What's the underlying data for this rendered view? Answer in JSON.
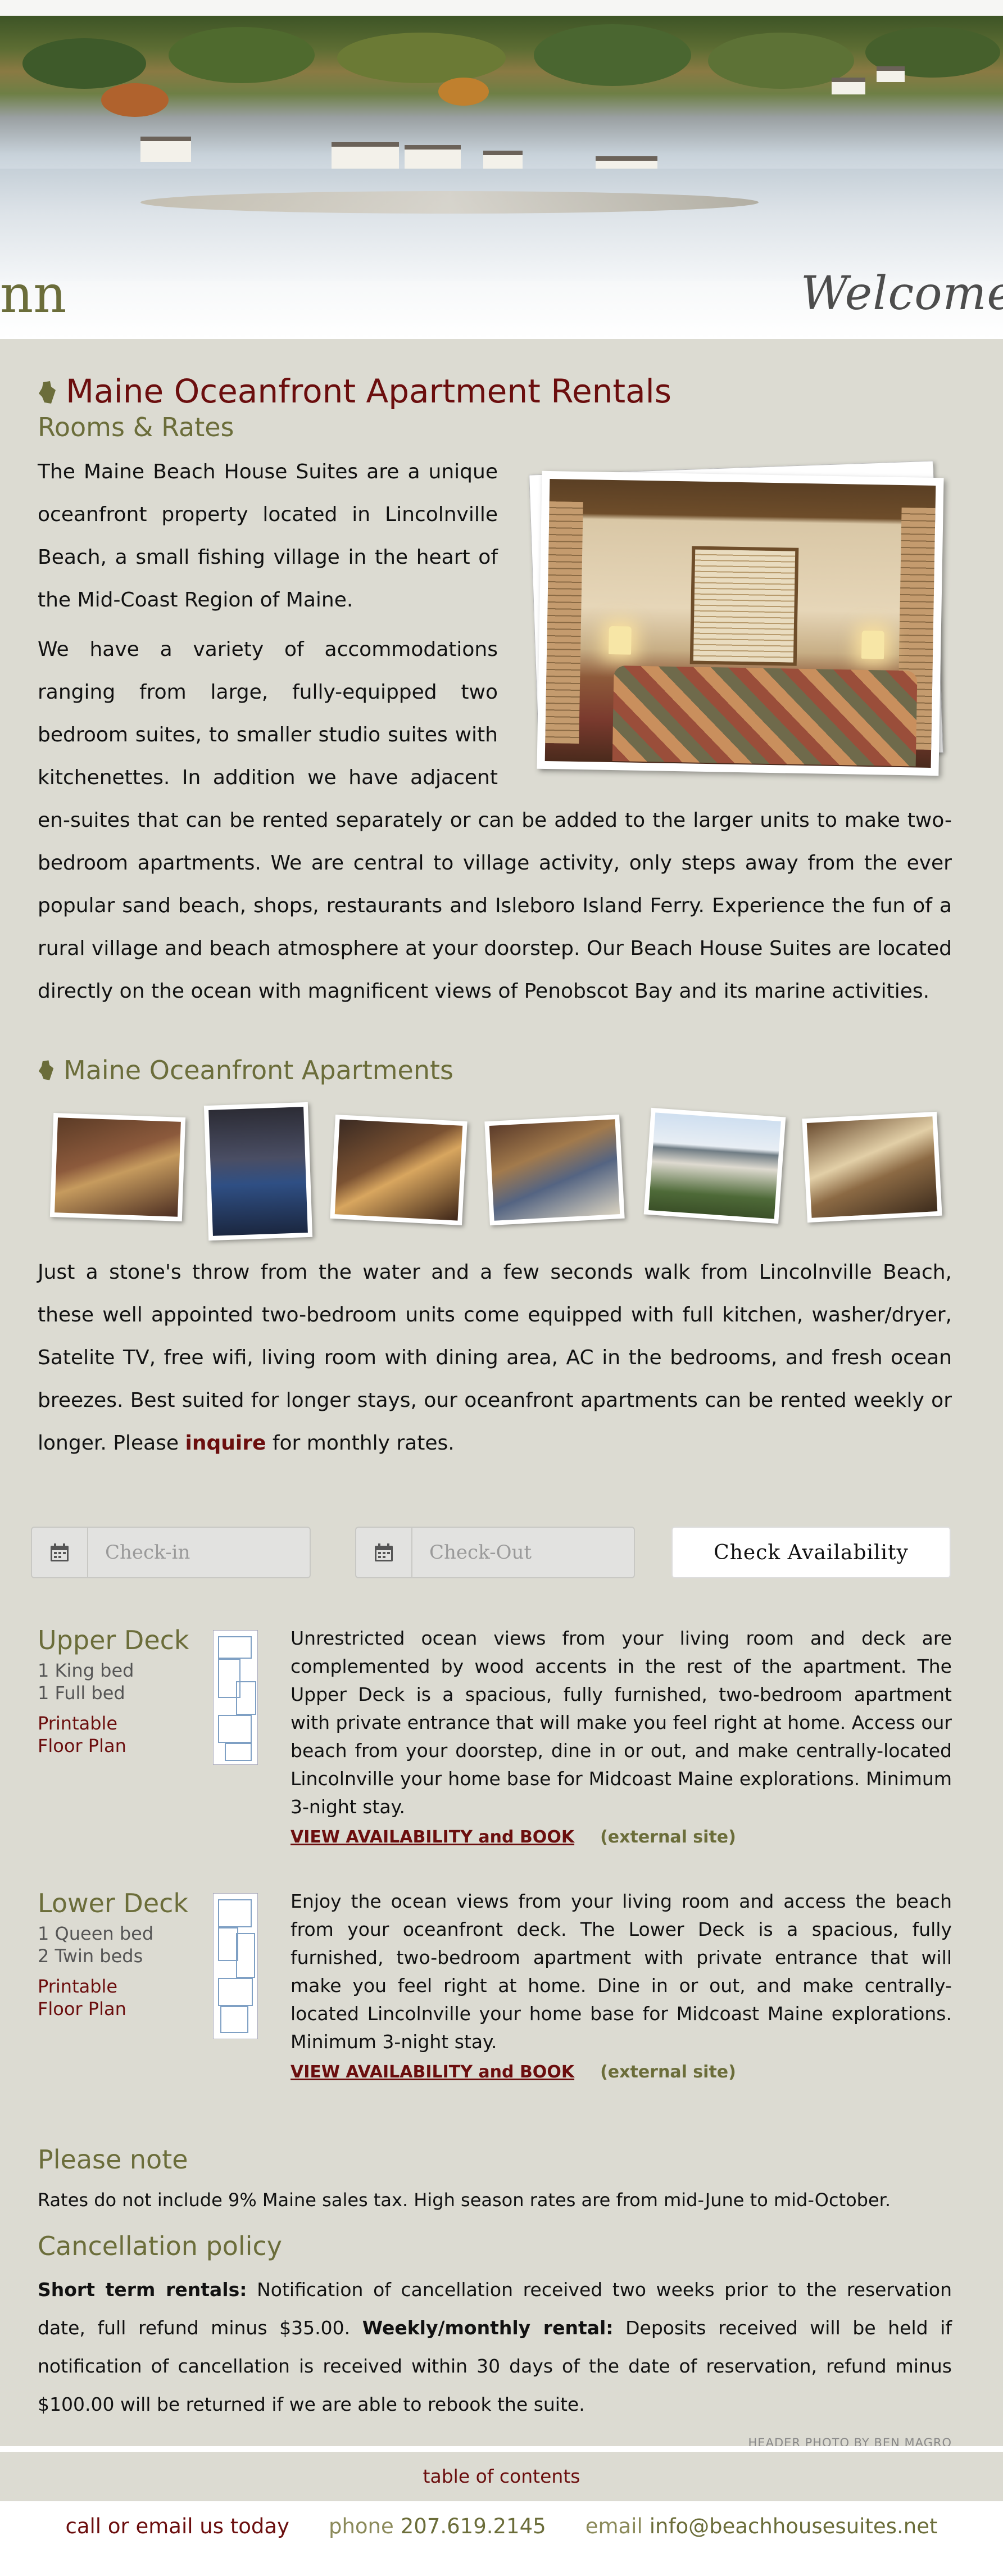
{
  "header": {
    "left_text": "nn",
    "right_text": "Welcome"
  },
  "intro": {
    "title": "Maine Oceanfront Apartment Rentals",
    "subtitle": "Rooms & Rates",
    "paragraph1": "The Maine Beach House Suites are a unique oceanfront property located in Lincolnville Beach, a small fishing village in the heart of the Mid-Coast Region of Maine.",
    "paragraph2": "We have a variety of accommodations ranging from large, fully-equipped two bedroom suites, to smaller studio suites with kitchenettes. In addition we have adjacent en-suites that can be rented separately or can be added to the larger units to make two-bedroom apartments. We are central to village activity, only steps away from the ever popular sand beach, shops, restaurants and Isleboro Island Ferry. Experience the fun of a rural village and beach atmosphere at your doorstep. Our Beach House Suites are located directly on the ocean with magnificent views of Penobscot Bay and its marine activities."
  },
  "apartments": {
    "title": "Maine Oceanfront Apartments",
    "description_before": "Just a stone's throw from the water and a few seconds walk from Lincolnville Beach, these well appointed two-bedroom units come equipped with full kitchen, washer/dryer, Satelite TV, free wifi, living room with dining area, AC in the bedrooms, and fresh ocean breezes. Best suited for longer stays, our oceanfront apartments can be rented weekly or longer. Please ",
    "inquire_link": "inquire",
    "description_after": " for monthly rates."
  },
  "booking": {
    "checkin_placeholder": "Check-in",
    "checkout_placeholder": "Check-Out",
    "check_button": "Check Availability"
  },
  "units": [
    {
      "name": "Upper Deck",
      "bed1": "1 King bed",
      "bed2": "1 Full bed",
      "plan_line1": "Printable",
      "plan_line2": "Floor Plan",
      "description": "Unrestricted ocean views from your living room and deck are complemented by wood accents in the rest of the apartment. The Upper Deck is a spacious, fully furnished, two-bedroom apartment with private entrance that will make you feel right at home. Access our beach from your doorstep, dine in or out, and make centrally-located Lincolnville your home base for Midcoast Maine explorations. Minimum 3-night stay.",
      "book_link": "VIEW AVAILABILITY and BOOK",
      "external_note": "(external site)"
    },
    {
      "name": "Lower Deck",
      "bed1": "1 Queen bed",
      "bed2": "2 Twin beds",
      "plan_line1": "Printable",
      "plan_line2": "Floor Plan",
      "description": "Enjoy the ocean views from your living room and access the beach from your oceanfront deck. The Lower Deck is a spacious, fully furnished, two-bedroom apartment with private entrance that will make you feel right at home. Dine in or out, and make centrally-located Lincolnville your home base for Midcoast Maine explorations. Minimum 3-night stay.",
      "book_link": "VIEW AVAILABILITY and BOOK",
      "external_note": "(external site)"
    }
  ],
  "notes": {
    "please_note_title": "Please note",
    "please_note_text": "Rates do not include 9% Maine sales tax. High season rates are from mid-June to mid-October.",
    "cancellation_title": "Cancellation policy",
    "short_term_label": "Short term rentals:",
    "short_term_text": " Notification of cancellation received two weeks prior to the reservation date, full refund minus $35.00. ",
    "monthly_label": "Weekly/monthly rental:",
    "monthly_text": " Deposits received will be held if notification of cancellation is received within 30 days of the date of reservation, refund minus $100.00 will be returned if we are able to rebook the suite.",
    "photo_credit": "HEADER PHOTO BY BEN MAGRO"
  },
  "footer": {
    "toc_link": "table of contents",
    "call_text": "call or email us today",
    "phone_label": "phone",
    "phone_value": "207.619.2145",
    "email_label": "email",
    "email_value": "info@beachhousesuites.net"
  },
  "colors": {
    "accent_maroon": "#6b0e0e",
    "accent_olive": "#6b6d3a",
    "background": "#dcdbd2"
  }
}
